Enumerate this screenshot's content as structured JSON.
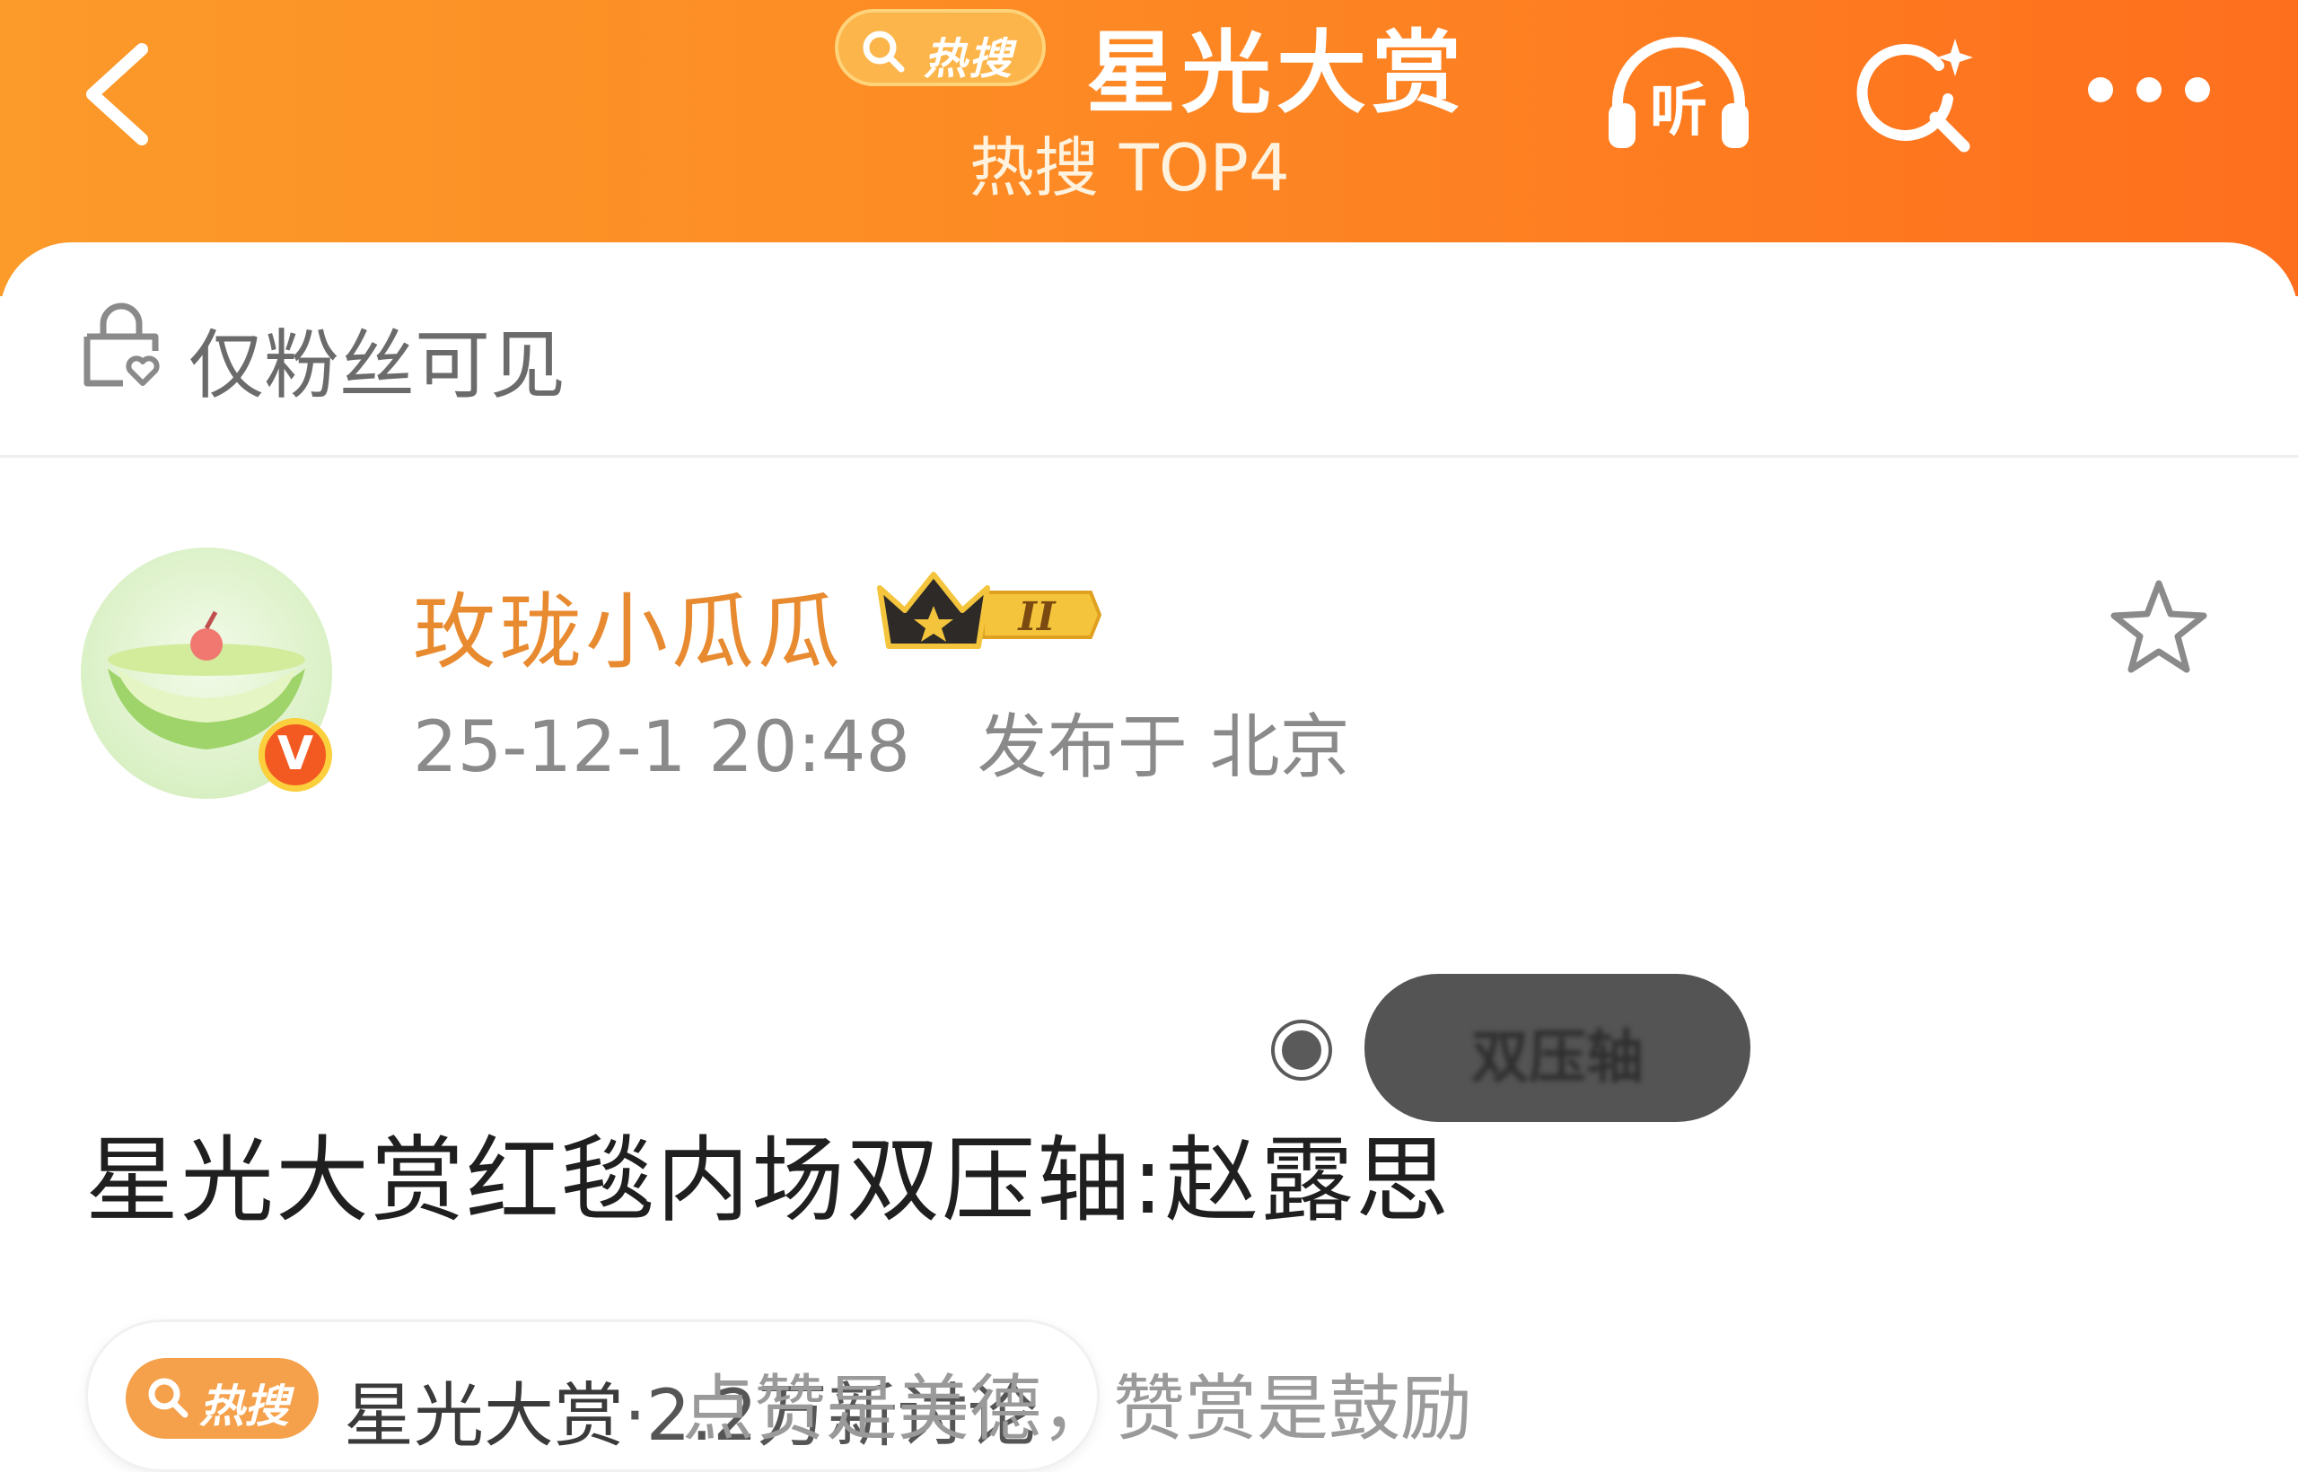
{
  "header": {
    "back_label": "back",
    "hot_search_badge": "热搜",
    "title": "星光大赏",
    "subtitle": "热搜 TOP4",
    "listen_label": "听"
  },
  "notice": {
    "text": "仅粉丝可见"
  },
  "post": {
    "author": "玫珑小瓜瓜",
    "level_badge": "II",
    "verified_mark": "V",
    "timestamp": "25-12-1 20:48",
    "location": "发布于 北京",
    "overlay_chip": "双压轴",
    "body": "星光大赏红毯内场双压轴:赵露思",
    "topic": {
      "hot_label": "热搜",
      "name": "星光大赏",
      "stats": "·2.2万新讨论"
    },
    "cutoff_text": "点赞是美德，赞赏是鼓励"
  },
  "colors": {
    "header_start": "#fc9a2a",
    "header_end": "#fe6f1d",
    "username": "#e88a30",
    "verified": "#f25a22"
  },
  "icons": [
    "chevron-left-icon",
    "search-icon",
    "headphones-icon",
    "ai-search-icon",
    "more-icon",
    "lock-heart-icon",
    "crown-icon",
    "star-icon",
    "melon-avatar"
  ]
}
